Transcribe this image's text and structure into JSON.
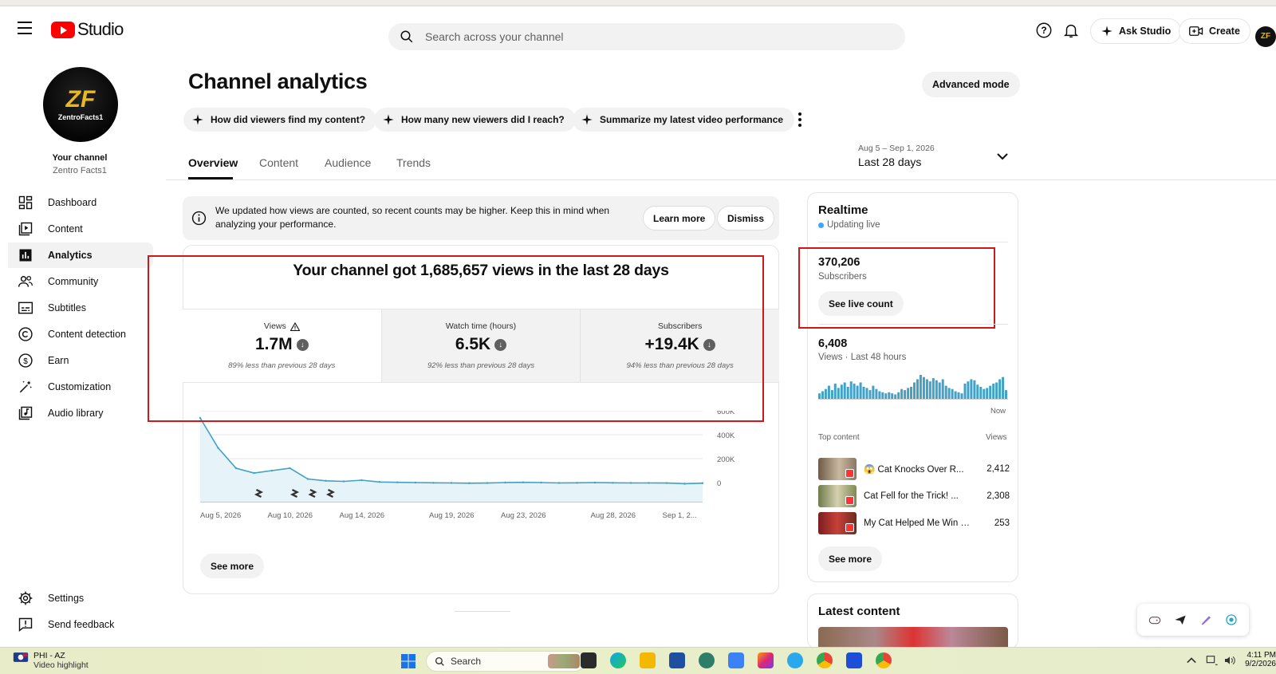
{
  "app": {
    "brand": "Studio",
    "brand_color": "#ff0000"
  },
  "header": {
    "search_placeholder": "Search across your channel",
    "ask_studio": "Ask Studio",
    "create": "Create",
    "avatar_text": "ZF"
  },
  "sidebar": {
    "avatar_logo": "ZF",
    "avatar_name": "ZentroFacts1",
    "your_channel": "Your channel",
    "channel_name": "Zentro Facts1",
    "items": [
      {
        "label": "Dashboard",
        "icon": "dashboard-icon"
      },
      {
        "label": "Content",
        "icon": "content-icon"
      },
      {
        "label": "Analytics",
        "icon": "analytics-icon",
        "active": true
      },
      {
        "label": "Community",
        "icon": "community-icon"
      },
      {
        "label": "Subtitles",
        "icon": "subtitles-icon"
      },
      {
        "label": "Content detection",
        "icon": "copyright-icon"
      },
      {
        "label": "Earn",
        "icon": "earn-icon"
      },
      {
        "label": "Customization",
        "icon": "customization-icon"
      },
      {
        "label": "Audio library",
        "icon": "audio-library-icon"
      }
    ],
    "settings": "Settings",
    "send_feedback": "Send feedback"
  },
  "page": {
    "title": "Channel analytics",
    "advanced_mode": "Advanced mode",
    "chips": [
      "How did viewers find my content?",
      "How many new viewers did I reach?",
      "Summarize my latest video performance"
    ],
    "tabs": [
      "Overview",
      "Content",
      "Audience",
      "Trends"
    ],
    "active_tab": "Overview",
    "date_range": {
      "dates": "Aug 5 – Sep 1, 2026",
      "label": "Last 28 days"
    }
  },
  "notice": {
    "text": "We updated how views are counted, so recent counts may be higher. Keep this in mind when analyzing your performance.",
    "learn_more": "Learn more",
    "dismiss": "Dismiss"
  },
  "overview": {
    "headline": "Your channel got 1,685,657 views in the last 28 days",
    "metrics": [
      {
        "label": "Views",
        "value": "1.7M",
        "change": "89% less than previous 28 days",
        "warning": true
      },
      {
        "label": "Watch time (hours)",
        "value": "6.5K",
        "change": "92% less than previous 28 days"
      },
      {
        "label": "Subscribers",
        "value": "+19.4K",
        "change": "94% less than previous 28 days"
      }
    ],
    "see_more": "See more"
  },
  "chart_data": {
    "type": "line",
    "series": [
      {
        "values": [
          540000,
          290000,
          120000,
          80000,
          100000,
          120000,
          30000,
          15000,
          10000,
          20000,
          5000,
          2000,
          0,
          -2000,
          -3000,
          -5000,
          -4000,
          0,
          2000,
          0,
          -3000,
          -2000,
          0,
          -2000,
          -3000,
          -3000,
          -4000,
          -10000,
          -5000
        ]
      }
    ],
    "x": [
      "Aug 5, 2026",
      "Aug 6",
      "Aug 7",
      "Aug 8",
      "Aug 9",
      "Aug 10, 2026",
      "Aug 11",
      "Aug 12",
      "Aug 13",
      "Aug 14, 2026",
      "Aug 15",
      "Aug 16",
      "Aug 17",
      "Aug 18",
      "Aug 19, 2026",
      "Aug 20",
      "Aug 21",
      "Aug 22",
      "Aug 23, 2026",
      "Aug 24",
      "Aug 25",
      "Aug 26",
      "Aug 27",
      "Aug 28, 2026",
      "Aug 29",
      "Aug 30",
      "Aug 31",
      "Sep 1, 2...",
      "Sep 1"
    ],
    "x_tick_labels": [
      "Aug 5, 2026",
      "Aug 10, 2026",
      "Aug 14, 2026",
      "Aug 19, 2026",
      "Aug 23, 2026",
      "Aug 28, 2026",
      "Sep 1, 2..."
    ],
    "y_tick_labels": [
      "600K",
      "400K",
      "200K",
      "0"
    ],
    "ylim": [
      -100000,
      600000
    ],
    "grid": true,
    "line_color": "#41a1c6",
    "upload_markers": [
      "Aug 8, 2026",
      "Aug 10, 2026",
      "Aug 11, 2026",
      "Aug 12, 2026"
    ]
  },
  "realtime": {
    "title": "Realtime",
    "status": "Updating live",
    "subscribers_value": "370,206",
    "subscribers_label": "Subscribers",
    "see_live_count": "See live count",
    "views_value": "6,408",
    "views_label": "Views · Last 48 hours",
    "now_label": "Now",
    "bar_values": [
      5,
      7,
      9,
      12,
      8,
      14,
      10,
      13,
      15,
      11,
      16,
      14,
      12,
      15,
      11,
      10,
      8,
      12,
      9,
      7,
      6,
      5,
      6,
      5,
      4,
      6,
      9,
      8,
      10,
      11,
      15,
      18,
      22,
      20,
      18,
      16,
      19,
      17,
      15,
      18,
      12,
      10,
      9,
      7,
      6,
      5,
      14,
      16,
      18,
      17,
      13,
      11,
      9,
      10,
      12,
      14,
      15,
      18,
      20,
      8
    ],
    "bar_color": "#41a1c6",
    "top_content_label": "Top content",
    "views_col_label": "Views",
    "top_content": [
      {
        "title": "😱 Cat Knocks Over R...",
        "views": "2,412"
      },
      {
        "title": "Cat Fell for the Trick! ...",
        "views": "2,308"
      },
      {
        "title": "My Cat Helped Me Win S...",
        "views": "253"
      }
    ],
    "see_more": "See more"
  },
  "latest_content": {
    "title": "Latest content"
  },
  "taskbar": {
    "weather_title": "PHI - AZ",
    "weather_sub": "Video highlight",
    "search": "Search",
    "time": "4:11 PM",
    "date": "9/2/2026"
  }
}
